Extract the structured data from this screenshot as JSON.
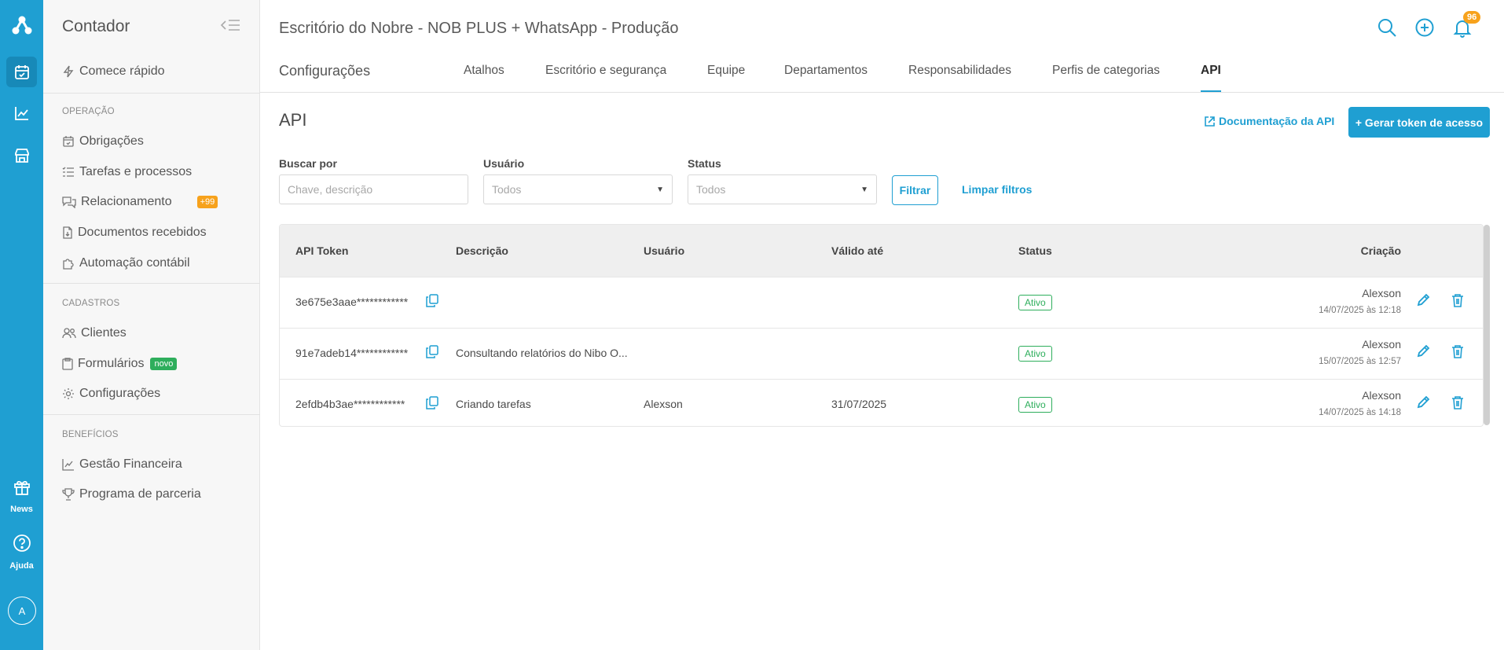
{
  "rail": {
    "news_label": "News",
    "help_label": "Ajuda",
    "avatar_initial": "A",
    "accent_color": "#1f9fd2"
  },
  "sidebar": {
    "title": "Contador",
    "quick_start": "Comece rápido",
    "sections": {
      "operacao": "OPERAÇÃO",
      "cadastros": "CADASTROS",
      "beneficios": "BENEFÍCIOS"
    },
    "items": {
      "obrigacoes": "Obrigações",
      "tarefas": "Tarefas e processos",
      "relacionamento": "Relacionamento",
      "relacionamento_badge": "+99",
      "documentos": "Documentos recebidos",
      "automacao": "Automação contábil",
      "clientes": "Clientes",
      "formularios": "Formulários",
      "formularios_badge": "novo",
      "configuracoes": "Configurações",
      "gestao": "Gestão Financeira",
      "parceria": "Programa de parceria"
    }
  },
  "header": {
    "title": "Escritório do Nobre - NOB PLUS + WhatsApp - Produção",
    "notifications_count": "96",
    "section": "Configurações",
    "tabs": [
      "Atalhos",
      "Escritório e segurança",
      "Equipe",
      "Departamentos",
      "Responsabilidades",
      "Perfis de categorias",
      "API"
    ],
    "active_tab": "API"
  },
  "page": {
    "title": "API",
    "doc_link": "Documentação da API",
    "primary_button": "+ Gerar token de acesso",
    "filters": {
      "search_label": "Buscar por",
      "search_placeholder": "Chave, descrição",
      "user_label": "Usuário",
      "user_value": "Todos",
      "status_label": "Status",
      "status_value": "Todos",
      "filter_button": "Filtrar",
      "clear_button": "Limpar filtros"
    },
    "table": {
      "columns": [
        "API Token",
        "Descrição",
        "Usuário",
        "Válido até",
        "Status",
        "Criação"
      ],
      "rows": [
        {
          "token": "3e675e3aae************",
          "description": "",
          "user": "",
          "valid_until": "",
          "status": "Ativo",
          "creator": "Alexson",
          "created": "14/07/2025 às 12:18"
        },
        {
          "token": "91e7adeb14************",
          "description": "Consultando relatórios do Nibo O...",
          "user": "",
          "valid_until": "",
          "status": "Ativo",
          "creator": "Alexson",
          "created": "15/07/2025 às 12:57"
        },
        {
          "token": "2efdb4b3ae************",
          "description": "Criando tarefas",
          "user": "Alexson",
          "valid_until": "31/07/2025",
          "status": "Ativo",
          "creator": "Alexson",
          "created": "14/07/2025 às 14:18"
        }
      ]
    }
  }
}
